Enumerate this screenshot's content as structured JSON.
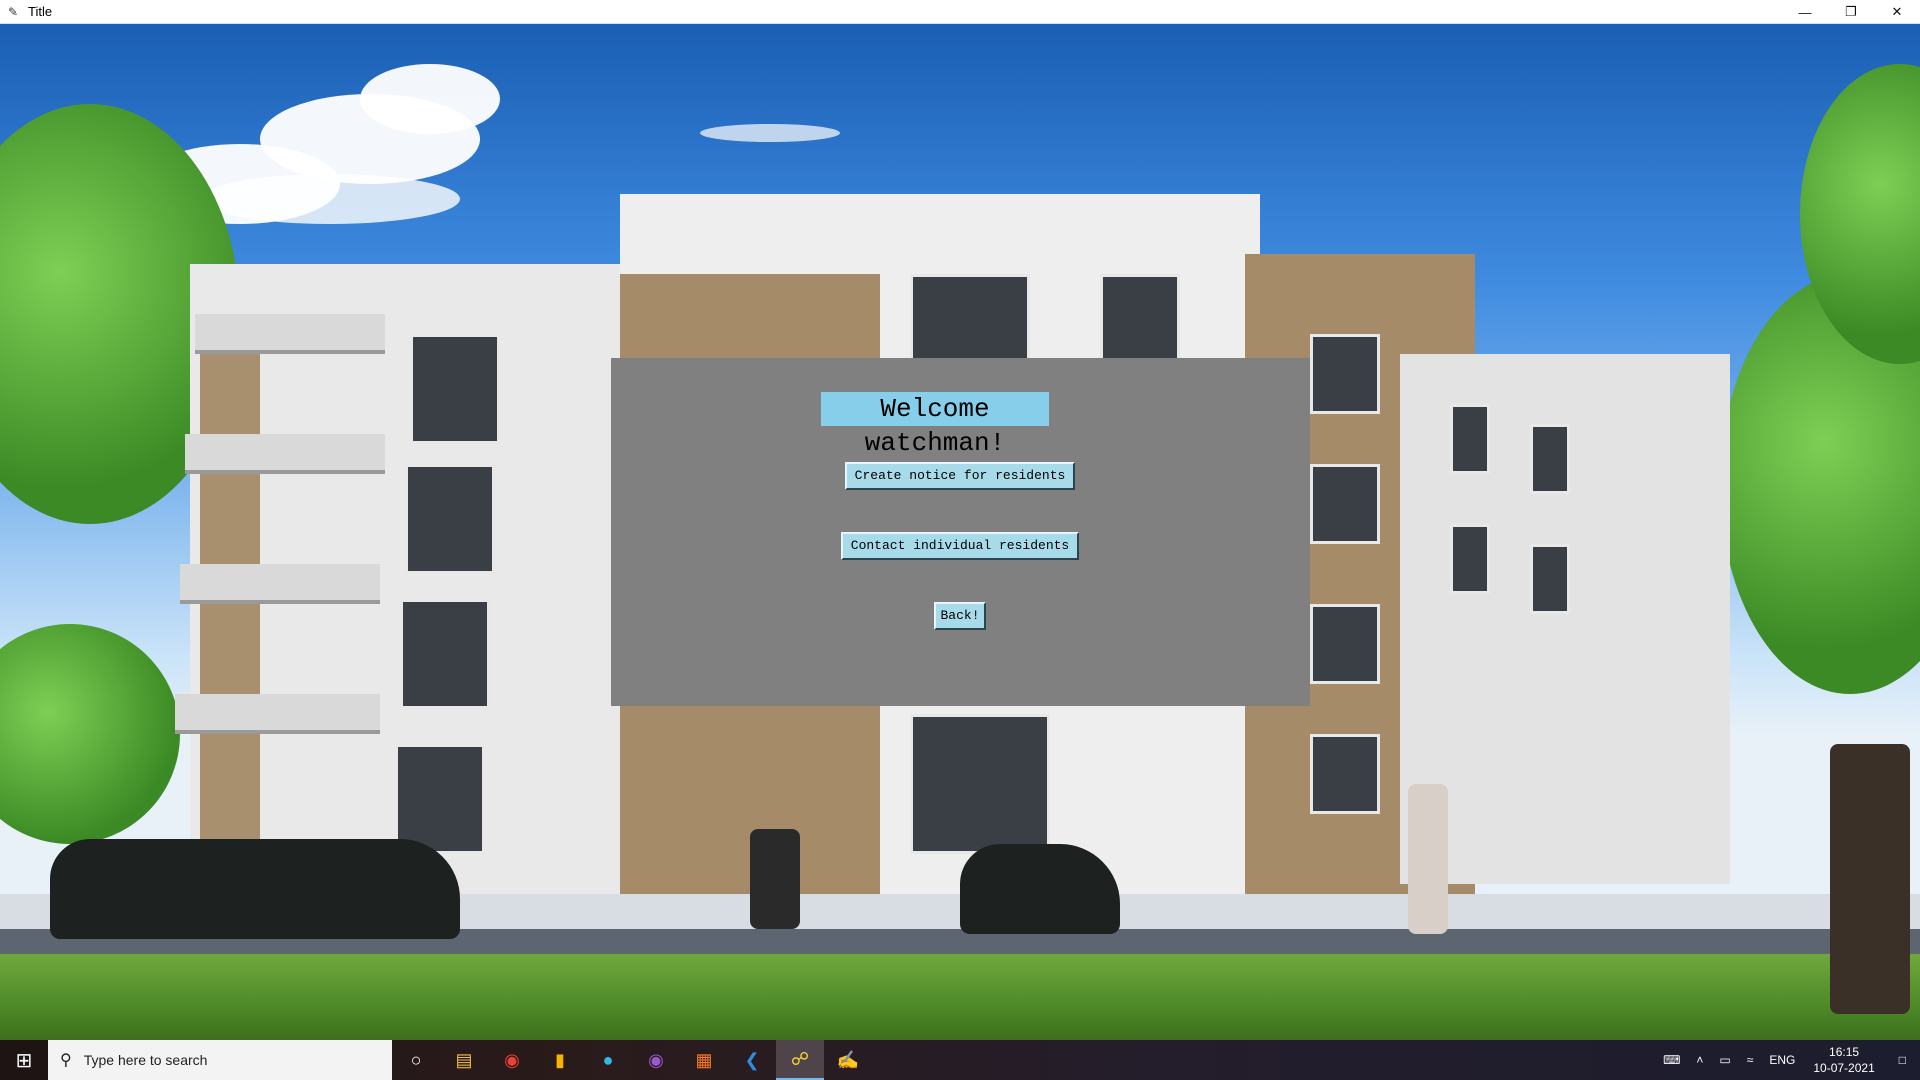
{
  "window": {
    "title": "Title",
    "minimize_icon": "minimize-icon",
    "restore_icon": "restore-icon",
    "close_icon": "close-icon"
  },
  "dialog": {
    "welcome_text": "Welcome watchman!",
    "create_notice_label": "Create notice for residents",
    "contact_residents_label": "Contact individual residents",
    "back_label": "Back!"
  },
  "taskbar": {
    "search_placeholder": "Type here to search",
    "apps": [
      "cortana-icon",
      "file-explorer-icon",
      "chrome-icon",
      "notes-icon",
      "edge-icon",
      "github-desktop-icon",
      "xampp-icon",
      "vscode-icon",
      "python-icon",
      "paint-icon"
    ],
    "language": "ENG",
    "time": "16:15",
    "date": "10-07-2021"
  },
  "colors": {
    "panel": "#808080",
    "welcome_bg": "#87ceeb",
    "button_bg": "#a8dbe9"
  }
}
